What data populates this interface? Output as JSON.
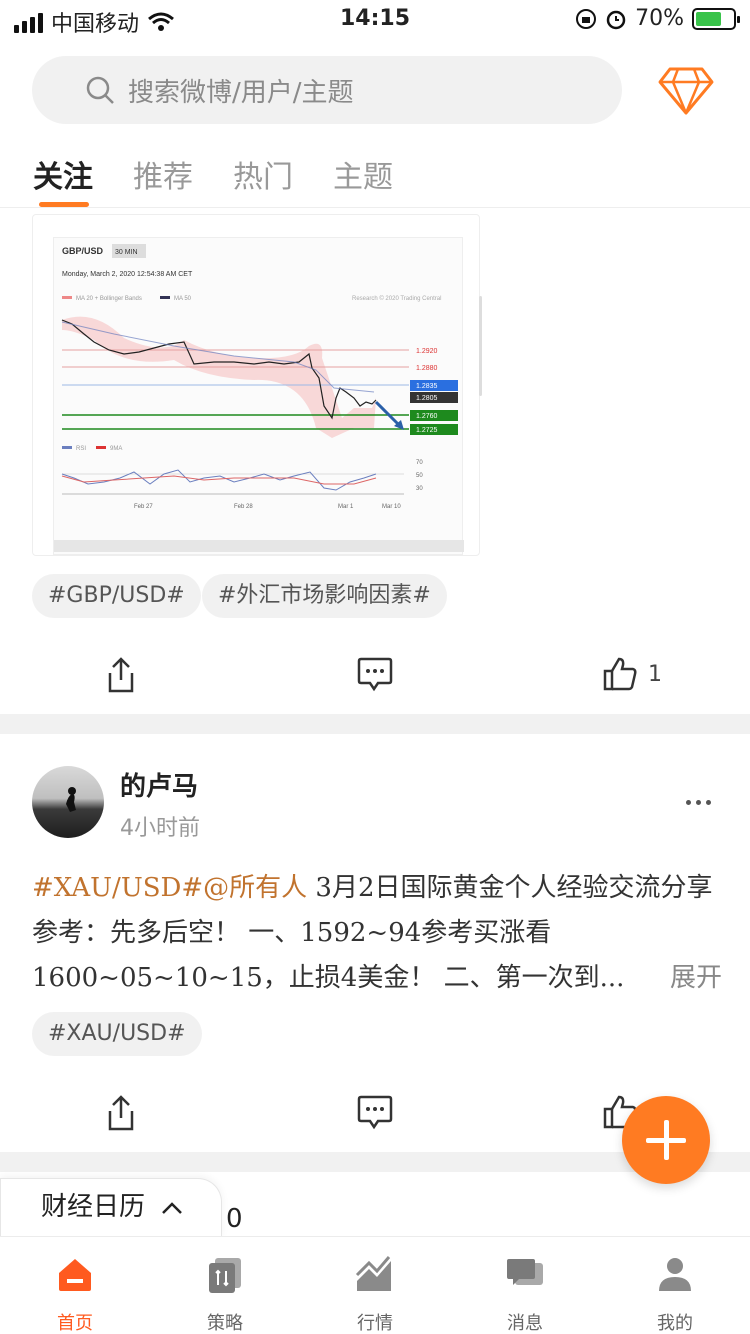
{
  "status": {
    "carrier": "中国移动",
    "time": "14:15",
    "battery": "70%"
  },
  "search": {
    "placeholder": "搜索微博/用户/主题"
  },
  "tabs": [
    {
      "label": "关注",
      "active": true
    },
    {
      "label": "推荐",
      "active": false
    },
    {
      "label": "热门",
      "active": false
    },
    {
      "label": "主题",
      "active": false
    }
  ],
  "post1": {
    "chart": {
      "symbol": "GBP/USD",
      "interval": "30 MIN",
      "datetime": "Monday, March 2, 2020 12:54:38 AM CET",
      "legend_ma20": "MA 20 + Bollinger Bands",
      "legend_ma50": "MA 50",
      "credit": "Research © 2020 Trading Central",
      "levels": [
        "1.2920",
        "1.2880",
        "1.2835",
        "1.2805",
        "1.2760",
        "1.2725"
      ],
      "rsi_legend": [
        "RSI",
        "9MA"
      ],
      "rsi_levels": [
        "70",
        "50",
        "30"
      ],
      "dates": [
        "Feb 27",
        "Feb 28",
        "Mar 1",
        "Mar 10"
      ]
    },
    "tags": [
      "#GBP/USD#",
      "#外汇市场影响因素#"
    ],
    "like_count": "1"
  },
  "post2": {
    "username": "的卢马",
    "time": "4小时前",
    "text_link": "#XAU/USD#@所有人",
    "text_body": " 3月2日国际黄金个人经验交流分享参考：先多后空！ 一、1592~94参考买涨看1600~05~10~15，止损4美金！ 二、第一次到...",
    "expand": "展开",
    "tags": [
      "#XAU/USD#"
    ]
  },
  "calendar": {
    "label": "财经日历"
  },
  "peek_text": "0",
  "nav": [
    {
      "label": "首页",
      "active": true
    },
    {
      "label": "策略",
      "active": false
    },
    {
      "label": "行情",
      "active": false
    },
    {
      "label": "消息",
      "active": false
    },
    {
      "label": "我的",
      "active": false
    }
  ],
  "colors": {
    "accent": "#ff7b22",
    "link": "#c1732e",
    "active_nav": "#ff5a1f"
  }
}
